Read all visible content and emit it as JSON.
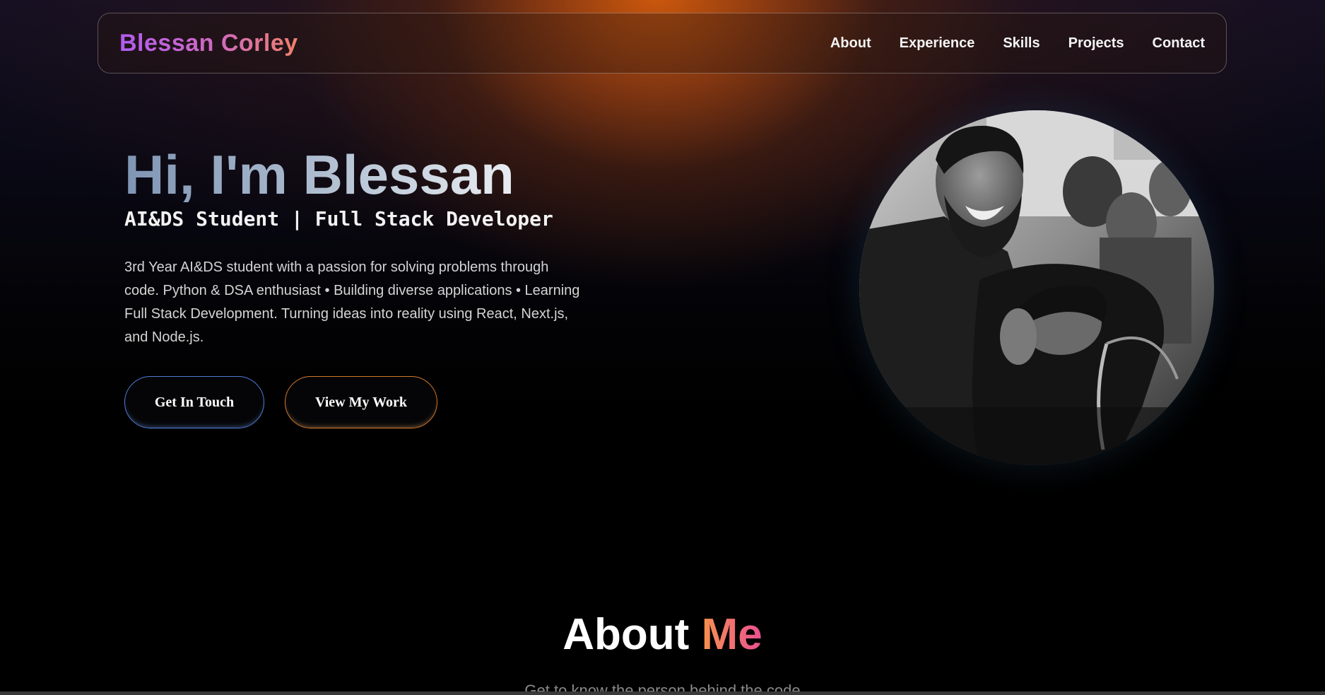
{
  "nav": {
    "brand": "Blessan Corley",
    "links": [
      {
        "label": "About"
      },
      {
        "label": "Experience"
      },
      {
        "label": "Skills"
      },
      {
        "label": "Projects"
      },
      {
        "label": "Contact"
      }
    ]
  },
  "hero": {
    "title": "Hi, I'm Blessan",
    "subtitle": "AI&DS Student | Full Stack Developer",
    "description": "3rd Year AI&DS student with a passion for solving problems through code. Python & DSA enthusiast • Building diverse applications • Learning Full Stack Development. Turning ideas into reality using React, Next.js, and Node.js.",
    "buttons": {
      "primary": "Get In Touch",
      "secondary": "View My Work"
    },
    "photo_icon": "profile-photo"
  },
  "about": {
    "heading_part1": "About",
    "heading_part2": "Me",
    "subtitle": "Get to know the person behind the code"
  },
  "colors": {
    "glow": "#d65c0c",
    "brand_gradient_start": "#b25cf0",
    "brand_gradient_end": "#f0806a",
    "primary_button_border": "#4f7bd8",
    "secondary_button_border": "#d4772a",
    "accent_me_start": "#f7914b",
    "accent_me_end": "#ea4f90"
  }
}
